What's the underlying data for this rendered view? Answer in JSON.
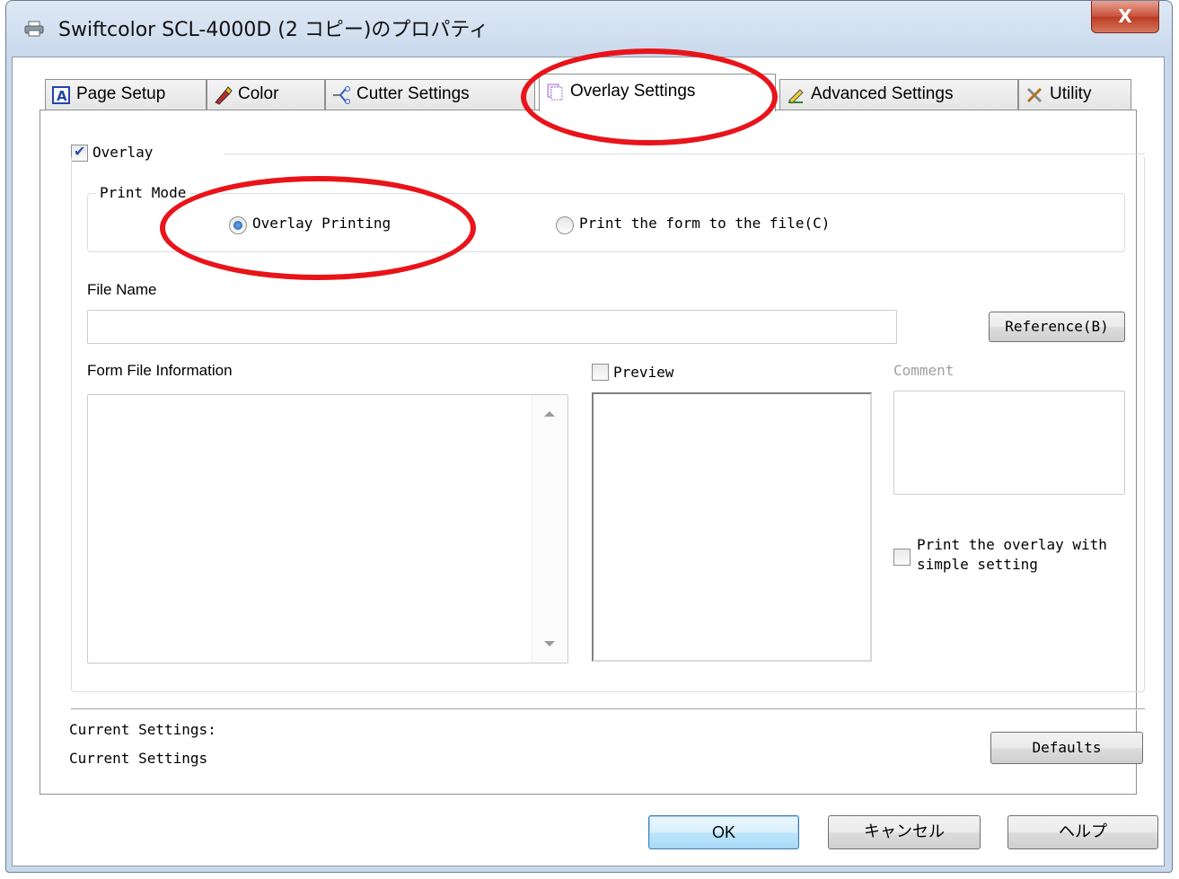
{
  "window": {
    "title": "Swiftcolor SCL-4000D (2 コピー)のプロパティ",
    "close_label": "X"
  },
  "tabs": [
    {
      "label": "Page Setup",
      "icon": "page-setup-icon"
    },
    {
      "label": "Color",
      "icon": "color-icon"
    },
    {
      "label": "Cutter Settings",
      "icon": "cutter-icon"
    },
    {
      "label": "Overlay Settings",
      "icon": "overlay-icon",
      "active": true
    },
    {
      "label": "Advanced Settings",
      "icon": "advanced-icon"
    },
    {
      "label": "Utility",
      "icon": "utility-icon"
    }
  ],
  "overlay": {
    "checkbox_label": "Overlay",
    "checked": true,
    "print_mode": {
      "title": "Print Mode",
      "options": [
        {
          "label": "Overlay Printing",
          "selected": true
        },
        {
          "label": "Print the form to the file(C)",
          "selected": false
        }
      ]
    },
    "file_name": {
      "label": "File Name",
      "value": "",
      "reference_button": "Reference(B)"
    },
    "form_file_info": {
      "label": "Form File Information"
    },
    "preview": {
      "label": "Preview",
      "checked": false
    },
    "comment": {
      "label": "Comment"
    },
    "simple_setting": {
      "label_line1": "Print the overlay with",
      "label_line2": "simple setting",
      "checked": false
    }
  },
  "footer": {
    "current_settings_label": "Current Settings:",
    "current_settings_value": "Current Settings",
    "defaults_button": "Defaults"
  },
  "buttons": {
    "ok": "OK",
    "cancel": "キャンセル",
    "help": "ヘルプ"
  },
  "colors": {
    "highlight_circle": "#e8141a",
    "accent_check": "#2d4fa8",
    "radio_selected": "#1d5ca8"
  }
}
